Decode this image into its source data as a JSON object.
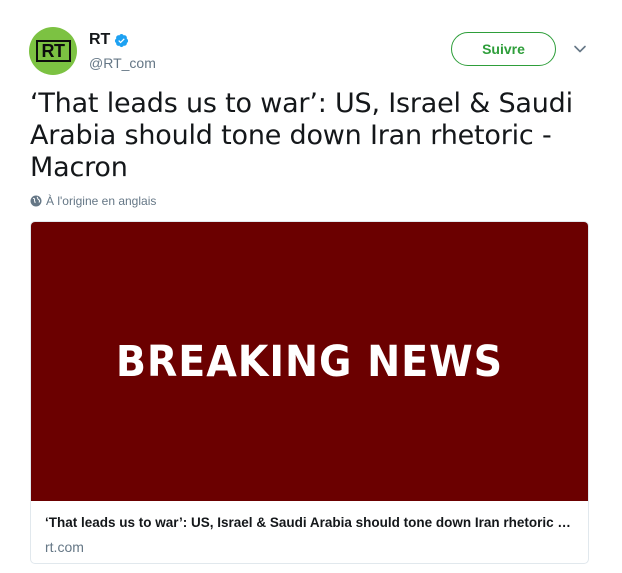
{
  "author": {
    "display_name": "RT",
    "handle": "@RT_com",
    "avatar_text": "RT",
    "verified": true,
    "avatar_color": "#7cc242"
  },
  "follow_button": {
    "label": "Suivre",
    "color": "#2e9e3a"
  },
  "tweet": {
    "text": "‘That leads us to war’: US, Israel & Saudi Arabia should tone down Iran rhetoric - Macron",
    "translation_note": "À l'origine en anglais"
  },
  "card": {
    "image_text": "BREAKING NEWS",
    "image_color": "#6b0000",
    "title": "‘That leads us to war’: US, Israel & Saudi Arabia should tone down Iran rhetoric - Macron",
    "domain": "rt.com"
  },
  "icons": {
    "verified": "verified-badge-icon",
    "menu": "chevron-down-icon",
    "globe": "globe-icon"
  }
}
